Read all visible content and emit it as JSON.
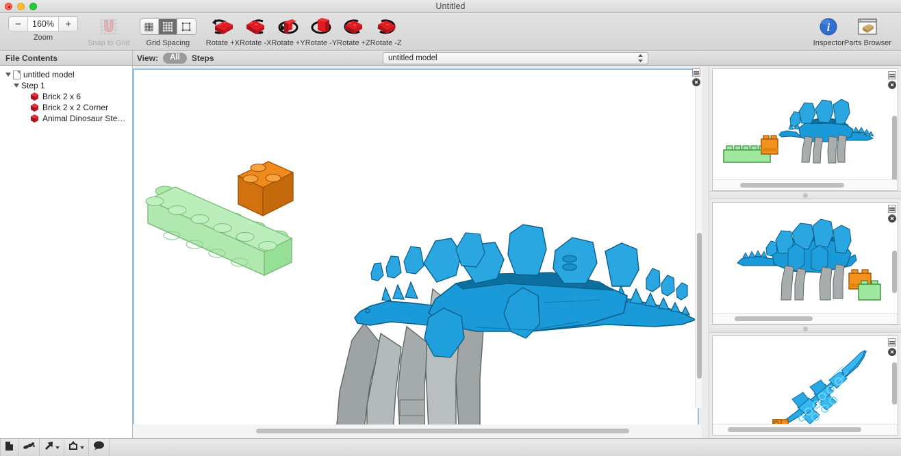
{
  "window": {
    "title": "Untitled",
    "traffic_lights": [
      "close",
      "minimize",
      "maximize"
    ]
  },
  "toolbar": {
    "zoom": {
      "label": "Zoom",
      "value": "160%",
      "minus": "−",
      "plus": "+"
    },
    "snap_to_grid": {
      "label": "Snap to Grid",
      "enabled": false,
      "icon": "magnet-icon"
    },
    "grid_spacing": {
      "label": "Grid Spacing",
      "options": [
        "fine-grid",
        "medium-grid",
        "coarse-grid"
      ],
      "selected_index": 1
    },
    "rotate_buttons": [
      {
        "label": "Rotate +X",
        "icon": "rotate-x-plus-icon"
      },
      {
        "label": "Rotate -X",
        "icon": "rotate-x-minus-icon"
      },
      {
        "label": "Rotate +Y",
        "icon": "rotate-y-plus-icon"
      },
      {
        "label": "Rotate -Y",
        "icon": "rotate-y-minus-icon"
      },
      {
        "label": "Rotate +Z",
        "icon": "rotate-z-plus-icon"
      },
      {
        "label": "Rotate -Z",
        "icon": "rotate-z-minus-icon"
      }
    ],
    "inspector": {
      "label": "Inspector",
      "icon": "info-icon"
    },
    "parts_browser": {
      "label": "Parts Browser",
      "icon": "parts-browser-icon"
    }
  },
  "viewbar": {
    "view_label": "View:",
    "all_label": "All",
    "steps_label": "Steps",
    "model_popup_value": "untitled model"
  },
  "sidebar": {
    "header": "File Contents",
    "tree": [
      {
        "label": "untitled model",
        "depth": 0,
        "icon": "document-icon",
        "expanded": true
      },
      {
        "label": "Step 1",
        "depth": 1,
        "icon": "none",
        "expanded": true
      },
      {
        "label": "Brick  2 x  6",
        "depth": 2,
        "icon": "brick-icon",
        "expanded": null
      },
      {
        "label": "Brick  2 x  2 Corner",
        "depth": 2,
        "icon": "brick-icon",
        "expanded": null
      },
      {
        "label": "Animal Dinosaur Ste…",
        "depth": 2,
        "icon": "brick-icon",
        "expanded": null
      }
    ]
  },
  "canvas": {
    "background": "#ffffff",
    "selection_border": "#8ec4f0",
    "split_button": "split-pane-icon",
    "close_button": "close-pane-icon",
    "models": [
      {
        "name": "brick-2x6-green",
        "color": "#7ed97e",
        "transparent": true
      },
      {
        "name": "brick-2x2-corner-orange",
        "color": "#e8871a",
        "transparent": false
      },
      {
        "name": "animal-dinosaur-stegosaurus-blue",
        "color": "#1e9cd7",
        "legs_color": "#a9a9a9"
      }
    ]
  },
  "thumbnails": [
    {
      "name": "view-thumbnail-1",
      "orientation": "front-right",
      "split_button": "split-pane-icon",
      "close_button": "close-pane-icon"
    },
    {
      "name": "view-thumbnail-2",
      "orientation": "front-left",
      "split_button": "split-pane-icon",
      "close_button": "close-pane-icon"
    },
    {
      "name": "view-thumbnail-3",
      "orientation": "top-diagonal",
      "split_button": "split-pane-icon",
      "close_button": "close-pane-icon"
    }
  ],
  "bottombar": {
    "buttons": [
      {
        "name": "new-document-button",
        "icon": "document-icon",
        "has_chevron": false
      },
      {
        "name": "parts-button",
        "icon": "pieces-icon",
        "has_chevron": false
      },
      {
        "name": "add-part-button",
        "icon": "arrow-up-right-icon",
        "has_chevron": true
      },
      {
        "name": "add-step-button",
        "icon": "arrow-up-box-icon",
        "has_chevron": true
      },
      {
        "name": "comment-button",
        "icon": "speech-bubble-icon",
        "has_chevron": false
      }
    ]
  },
  "colors": {
    "accent_selection": "#8ec4f0",
    "brick_red": "#c8102e",
    "model_blue": "#1e9cd7",
    "model_green": "#7ed97e",
    "model_orange": "#e8871a",
    "model_gray": "#a9a9a9"
  }
}
